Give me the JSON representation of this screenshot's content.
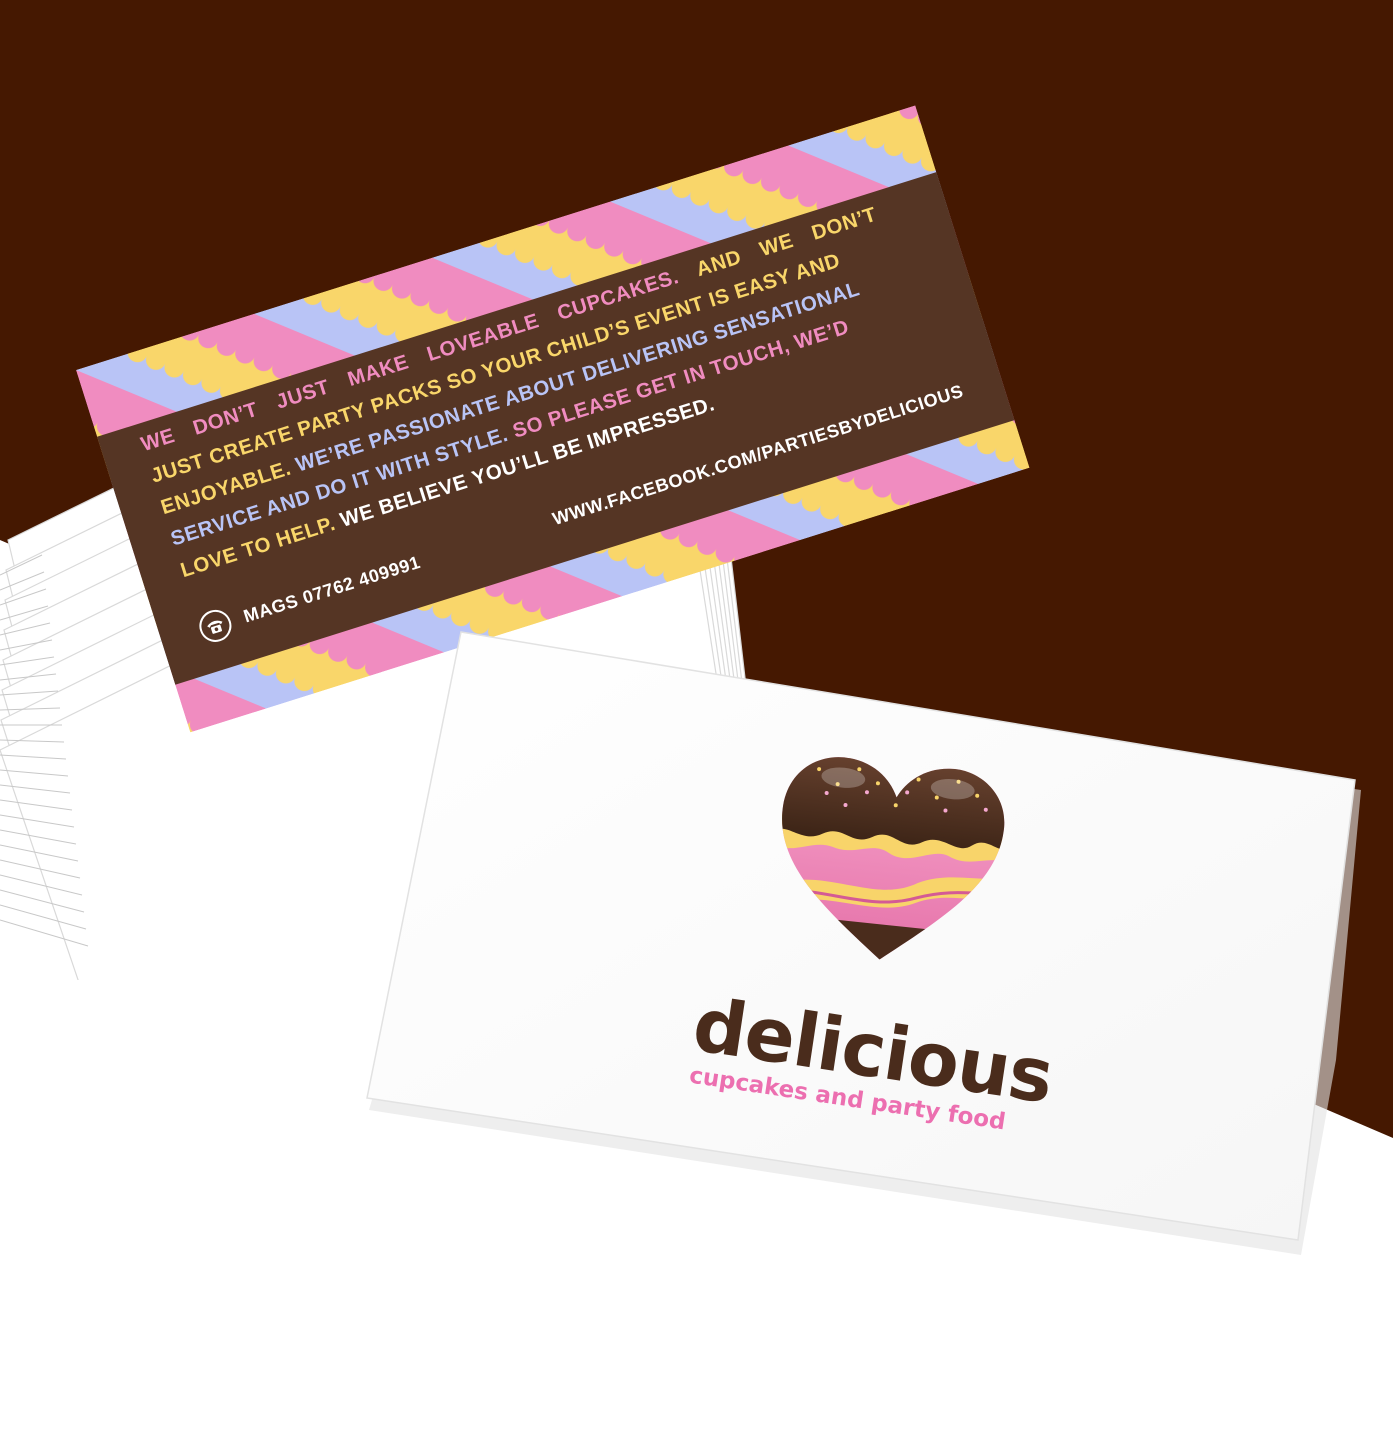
{
  "colors": {
    "background_brown": "#451801",
    "chocolate": "#553524",
    "pink": "#f08cc0",
    "yellow": "#f9d66a",
    "lavender": "#b9c4f6",
    "white": "#ffffff"
  },
  "back_card": {
    "lines": [
      [
        {
          "text": "WE DON’T JUST MAKE LOVEABLE CUPCAKES.",
          "color": "pink"
        },
        {
          "text": " AND WE DON’T",
          "color": "yellow"
        }
      ],
      [
        {
          "text": "JUST CREATE PARTY PACKS SO YOUR CHILD’S EVENT IS EASY AND",
          "color": "yellow"
        }
      ],
      [
        {
          "text": "ENJOYABLE.",
          "color": "yellow"
        },
        {
          "text": " WE’RE PASSIONATE ABOUT DELIVERING SENSATIONAL",
          "color": "lavender"
        }
      ],
      [
        {
          "text": "SERVICE AND DO IT WITH STYLE.",
          "color": "lavender"
        },
        {
          "text": " SO PLEASE GET IN TOUCH, WE’D",
          "color": "pink"
        }
      ],
      [
        {
          "text": "LOVE TO HELP.",
          "color": "yellow"
        },
        {
          "text": " WE BELIEVE YOU’LL BE IMPRESSED.",
          "color": "white"
        }
      ]
    ],
    "phone_icon": "telephone-icon",
    "phone": "MAGS 07762 409991",
    "website": "WWW.FACEBOOK.COM/PARTIESBYDELICIOUS"
  },
  "front_card": {
    "logo_icon": "chocolate-heart-cupcake-icon",
    "brand_name": "delicious",
    "tagline": "cupcakes and party food"
  }
}
